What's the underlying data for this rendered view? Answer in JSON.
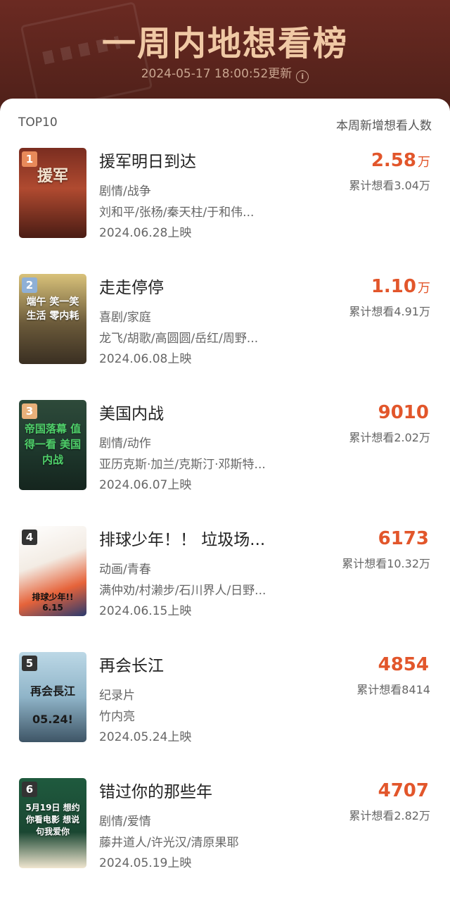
{
  "header": {
    "title": "一周内地想看榜",
    "updated": "2024-05-17 18:00:52更新",
    "info_icon": "info-icon"
  },
  "list_header": {
    "left": "TOP10",
    "right": "本周新增想看人数"
  },
  "colors": {
    "accent": "#e2562b",
    "banner": "#5a2a22",
    "banner_title": "#f0c9a5"
  },
  "movies": [
    {
      "rank": "1",
      "title": "援军明日到达",
      "genre": "剧情/战争",
      "cast": "刘和平/张杨/秦天柱/于和伟...",
      "release": "2024.06.28上映",
      "new_count": "2.58",
      "unit": "万",
      "total": "累计想看3.04万",
      "poster_text": "援军"
    },
    {
      "rank": "2",
      "title": "走走停停",
      "genre": "喜剧/家庭",
      "cast": "龙飞/胡歌/高圆圆/岳红/周野...",
      "release": "2024.06.08上映",
      "new_count": "1.10",
      "unit": "万",
      "total": "累计想看4.91万",
      "poster_text": "端午 笑一笑 生活 零内耗"
    },
    {
      "rank": "3",
      "title": "美国内战",
      "genre": "剧情/动作",
      "cast": "亚历克斯·加兰/克斯汀·邓斯特...",
      "release": "2024.06.07上映",
      "new_count": "9010",
      "unit": "",
      "total": "累计想看2.02万",
      "poster_text": "帝国落幕 值得一看 美国内战"
    },
    {
      "rank": "4",
      "title": "排球少年！！ 垃圾场...",
      "genre": "动画/青春",
      "cast": "满仲劝/村濑步/石川界人/日野...",
      "release": "2024.06.15上映",
      "new_count": "6173",
      "unit": "",
      "total": "累计想看10.32万",
      "poster_text": "排球少年!! 6.15"
    },
    {
      "rank": "5",
      "title": "再会长江",
      "genre": "纪录片",
      "cast": "竹内亮",
      "release": "2024.05.24上映",
      "new_count": "4854",
      "unit": "",
      "total": "累计想看8414",
      "poster_text": "再会長江 05.24!"
    },
    {
      "rank": "6",
      "title": "错过你的那些年",
      "genre": "剧情/爱情",
      "cast": "藤井道人/许光汉/清原果耶",
      "release": "2024.05.19上映",
      "new_count": "4707",
      "unit": "",
      "total": "累计想看2.82万",
      "poster_text": "5月19日 想约你看电影 想说句我爱你"
    }
  ]
}
